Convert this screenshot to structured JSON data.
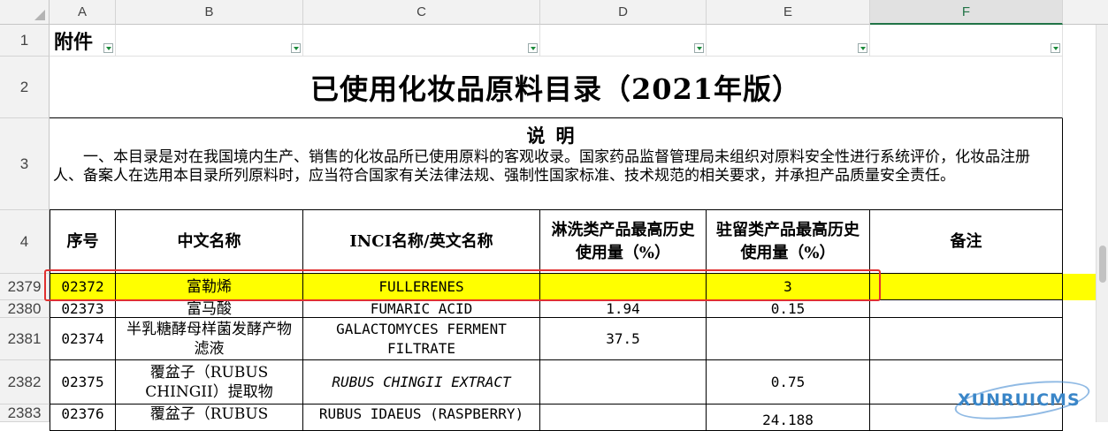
{
  "columns": [
    "A",
    "B",
    "C",
    "D",
    "E",
    "F"
  ],
  "row_numbers": [
    "1",
    "2",
    "3",
    "4",
    "2379",
    "2380",
    "2381",
    "2382",
    "2383"
  ],
  "attachment_label": "附件",
  "title": "已使用化妆品原料目录（2021年版）",
  "note": {
    "heading": "说明",
    "body": "　　一、本目录是对在我国境内生产、销售的化妆品所已使用原料的客观收录。国家药品监督管理局未组织对原料安全性进行系统评价，化妆品注册人、备案人在选用本目录所列原料时，应当符合国家有关法律法规、强制性国家标准、技术规范的相关要求，并承担产品质量安全责任。"
  },
  "headers": {
    "seq": "序号",
    "cn_name": "中文名称",
    "inci": "INCI名称/英文名称",
    "rinse": "淋洗类产品最高历史使用量（%）",
    "leave": "驻留类产品最高历史使用量（%）",
    "remark": "备注"
  },
  "rows": [
    {
      "seq": "02372",
      "cn": "富勒烯",
      "inci": "FULLERENES",
      "rinse": "",
      "leave": "3",
      "remark": ""
    },
    {
      "seq": "02373",
      "cn": "富马酸",
      "inci": "FUMARIC ACID",
      "rinse": "1.94",
      "leave": "0.15",
      "remark": ""
    },
    {
      "seq": "02374",
      "cn": "半乳糖酵母样菌发酵产物滤液",
      "inci": "GALACTOMYCES FERMENT FILTRATE",
      "rinse": "37.5",
      "leave": "",
      "remark": ""
    },
    {
      "seq": "02375",
      "cn": "覆盆子（RUBUS CHINGII）提取物",
      "inci": "RUBUS CHINGII EXTRACT",
      "rinse": "",
      "leave": "0.75",
      "remark": ""
    },
    {
      "seq": "02376",
      "cn": "覆盆子（RUBUS",
      "inci": "RUBUS IDAEUS (RASPBERRY)",
      "rinse": "",
      "leave": "24.188",
      "remark": ""
    }
  ],
  "watermark": "XUNRUICMS",
  "colors": {
    "highlight_row": "#ffff00",
    "annotation_box": "#e03030",
    "header_bg": "#f2f2f2"
  }
}
